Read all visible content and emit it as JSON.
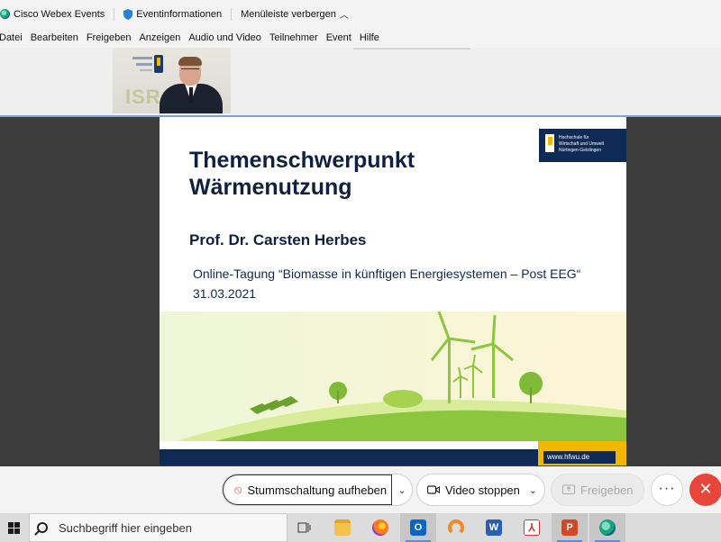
{
  "titlebar": {
    "app_name": "Cisco Webex Events",
    "event_info": "Eventinformationen",
    "hide_menu": "Menüleiste verbergen"
  },
  "menu": {
    "items": [
      "Datei",
      "Bearbeiten",
      "Freigeben",
      "Anzeigen",
      "Audio und Video",
      "Teilnehmer",
      "Event",
      "Hilfe"
    ]
  },
  "video_tile": {
    "background_letters": "ISR"
  },
  "slide": {
    "title": "Themenschwerpunkt\nWärmenutzung",
    "author": "Prof. Dr. Carsten Herbes",
    "event": "Online-Tagung “Biomasse in künftigen Energiesystemen – Post EEG“",
    "date": "31.03.2021",
    "logo_lines": [
      "Hochschule für",
      "Wirtschaft und Umwelt",
      "Nürtingen-Geislingen"
    ],
    "footer_url": "www.hfwu.de",
    "colors": {
      "navy": "#0f2a55",
      "yellow": "#f2b700",
      "green": "#8cc63f"
    }
  },
  "controls": {
    "unmute_label": "Stummschaltung aufheben",
    "video_label": "Video stoppen",
    "share_label": "Freigeben",
    "more_label": "···",
    "leave_label": "✕"
  },
  "taskbar": {
    "search_placeholder": "Suchbegriff hier eingeben",
    "apps": [
      {
        "name": "task-view-icon"
      },
      {
        "name": "file-explorer-icon"
      },
      {
        "name": "firefox-icon"
      },
      {
        "name": "outlook-icon"
      },
      {
        "name": "orange-ring-app-icon"
      },
      {
        "name": "word-icon"
      },
      {
        "name": "acrobat-icon"
      },
      {
        "name": "powerpoint-icon"
      },
      {
        "name": "webex-icon"
      }
    ]
  }
}
